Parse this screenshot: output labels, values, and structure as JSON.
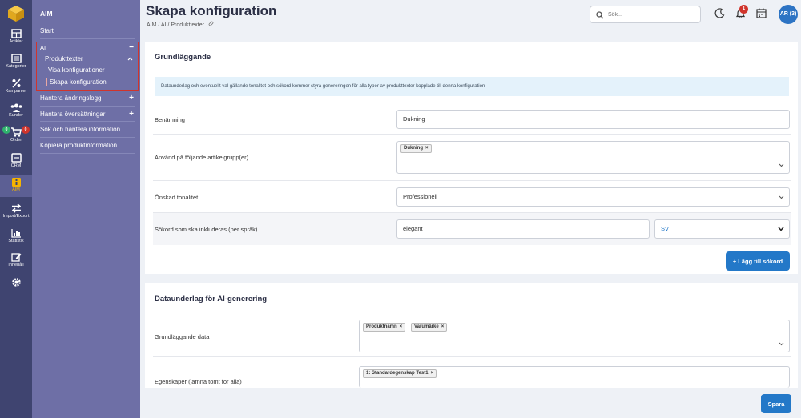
{
  "rail": [
    {
      "label": "Artiklar",
      "icon": "box-icon"
    },
    {
      "label": "Kategorier",
      "icon": "list-icon"
    },
    {
      "label": "Kampanjer",
      "icon": "percent-icon"
    },
    {
      "label": "Kunder",
      "icon": "users-icon"
    },
    {
      "label": "Order",
      "icon": "cart-icon",
      "badge_left": "0",
      "badge_right": "0"
    },
    {
      "label": "CRM",
      "icon": "crm-icon"
    },
    {
      "label": "AIM",
      "icon": "aim-icon"
    },
    {
      "label": "Import/Export",
      "icon": "arrows-icon"
    },
    {
      "label": "Statistik",
      "icon": "chart-icon"
    },
    {
      "label": "Innehåll",
      "icon": "edit-icon"
    }
  ],
  "panel": {
    "title": "AIM",
    "start": "Start",
    "ai": "AI",
    "ai_toggle": "−",
    "produkttexter": "Produkttexter",
    "visa": "Visa konfigurationer",
    "skapa": "Skapa konfiguration",
    "andringslogg": "Hantera ändringslogg",
    "oversattningar": "Hantera översättningar",
    "sok": "Sök och hantera information",
    "kopiera": "Kopiera produktinformation",
    "plus": "+"
  },
  "header": {
    "title": "Skapa konfiguration",
    "breadcrumb": "AIM / AI / Produkttexter",
    "search_placeholder": "Sök...",
    "notif_count": "1",
    "avatar": "AR (3)"
  },
  "basic": {
    "heading": "Grundläggande",
    "info": "Dataunderlag och eventuellt val gällande tonalitet och sökord kommer styra genereringen för alla typer av produkttexter kopplade till denna konfiguration",
    "name_label": "Benämning",
    "name_value": "Dukning",
    "groups_label": "Använd på följande artikelgrupp(er)",
    "groups_tags": [
      "Dukning"
    ],
    "tone_label": "Önskad tonalitet",
    "tone_value": "Professionell",
    "keywords_label": "Sökord som ska inkluderas (per språk)",
    "keyword_value": "elegant",
    "lang_value": "SV",
    "add_keyword": "+ Lägg till sökord"
  },
  "data": {
    "heading": "Dataunderlag för AI-generering",
    "basic_label": "Grundläggande data",
    "basic_tags": [
      "Produktnamn",
      "Varumärke"
    ],
    "props_label": "Egenskaper (lämna tomt för alla)",
    "props_tags": [
      "1: Standardegenskap Test1"
    ]
  },
  "save": "Spara",
  "colors": {
    "rail": "#3f4470",
    "panel": "#6e6fa6",
    "accent": "#2378c8",
    "active": "#f5b400",
    "badge_red": "#d0342c",
    "badge_green": "#2fb36d"
  }
}
